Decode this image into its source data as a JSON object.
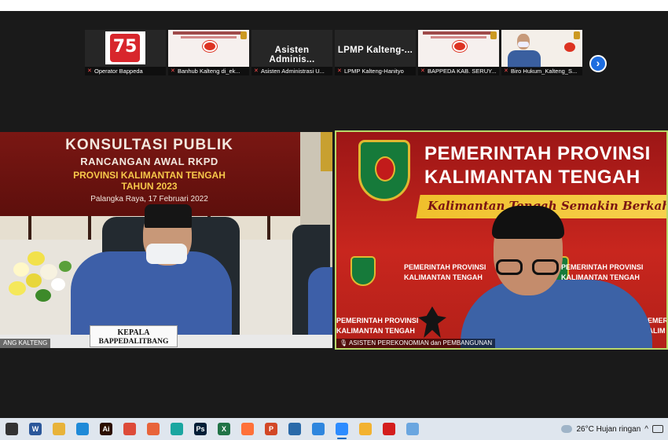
{
  "gallery": {
    "thumbnails": [
      {
        "type": "logo",
        "logo_text": "75",
        "caption": "Operator Bappeda"
      },
      {
        "type": "poster",
        "caption": "Banhub Kalteng di_ek..."
      },
      {
        "type": "text",
        "big_name": "Asisten Adminis...",
        "caption": "Asisten Administrasi U..."
      },
      {
        "type": "text",
        "big_name": "LPMP Kalteng-...",
        "caption": "LPMP Kalteng-Hanityo"
      },
      {
        "type": "poster",
        "caption": "BAPPEDA KAB. SERUY..."
      },
      {
        "type": "person",
        "caption": "Biro Hukum_Kalteng_S..."
      }
    ],
    "next_icon": "chevron-right-icon",
    "accent": "#1e6de0"
  },
  "video_left": {
    "banner_line1": "KONSULTASI PUBLIK",
    "banner_line2": "RANCANGAN AWAL RKPD",
    "banner_line3": "PROVINSI KALIMANTAN TENGAH",
    "banner_line4": "TAHUN 2023",
    "banner_line5": "Palangka Raya, 17 Februari 2022",
    "nameplate_line1": "KEPALA",
    "nameplate_line2": "BAPPEDALITBANG",
    "caption": "ANG KALTENG"
  },
  "video_right": {
    "title_line1": "PEMERINTAH PROVINSI",
    "title_line2": "KALIMANTAN TENGAH",
    "tagline": "Kalimantan Tengah Semakin Berkah",
    "small_a_line1": "PEMERINTAH PROVINSI",
    "small_a_line2": "KALIMANTAN TENGAH",
    "small_b_line1": "PEMERINTAH PROVINSI",
    "small_b_line2": "KALIMANTAN TENGAH",
    "small_c_line1": "PEMERINTAH PROVINSI",
    "small_c_line2": "KALIMANTAN TENGAH",
    "small_d_line1": "PEMER",
    "small_d_line2": "KALIM",
    "caption": "ASISTEN PEREKONOMIAN dan PEMBANGUNAN",
    "active_border": "#b8d86a"
  },
  "taskbar": {
    "apps": [
      {
        "icon": "task-view-icon",
        "label": "",
        "color": "#333333"
      },
      {
        "icon": "word-icon",
        "label": "W",
        "color": "#2b579a"
      },
      {
        "icon": "file-explorer-icon",
        "label": "",
        "color": "#e8b33a"
      },
      {
        "icon": "outlook-icon",
        "label": "",
        "color": "#1f8ad8"
      },
      {
        "icon": "illustrator-icon",
        "label": "Ai",
        "color": "#2b0f00"
      },
      {
        "icon": "chrome-icon",
        "label": "",
        "color": "#dd4b39"
      },
      {
        "icon": "mail-icon",
        "label": "",
        "color": "#e8643a"
      },
      {
        "icon": "edge-icon",
        "label": "",
        "color": "#1aa6a0"
      },
      {
        "icon": "photoshop-icon",
        "label": "Ps",
        "color": "#001e36"
      },
      {
        "icon": "excel-icon",
        "label": "X",
        "color": "#217346"
      },
      {
        "icon": "firefox-icon",
        "label": "",
        "color": "#ff7139"
      },
      {
        "icon": "powerpoint-icon",
        "label": "P",
        "color": "#d24726"
      },
      {
        "icon": "virtualbox-icon",
        "label": "",
        "color": "#2a6aa9"
      },
      {
        "icon": "remote-desktop-icon",
        "label": "",
        "color": "#2e86de"
      },
      {
        "icon": "zoom-icon",
        "label": "",
        "color": "#2d8cff"
      },
      {
        "icon": "media-player-icon",
        "label": "",
        "color": "#f2b230"
      },
      {
        "icon": "acrobat-icon",
        "label": "",
        "color": "#d41e1e"
      },
      {
        "icon": "paint-icon",
        "label": "",
        "color": "#6aa6e0"
      }
    ],
    "weather": "26°C  Hujan ringan",
    "tray_chevron": "^"
  }
}
